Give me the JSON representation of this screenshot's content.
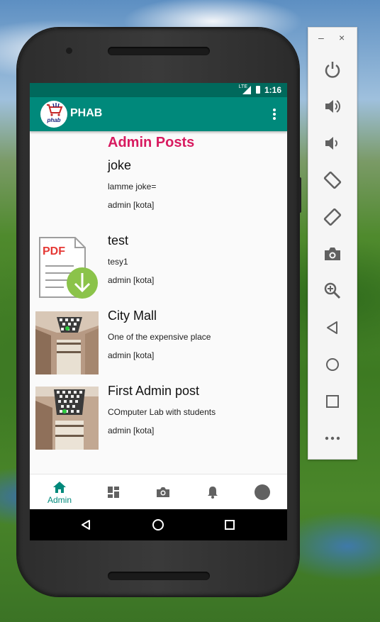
{
  "status_bar": {
    "time": "1:16",
    "network": "LTE"
  },
  "app_bar": {
    "title": "PHAB",
    "logo_text": "PHAB"
  },
  "page": {
    "section_title": "Admin Posts"
  },
  "posts": [
    {
      "title": "joke",
      "description": "lamme joke=",
      "author": "admin [kota]",
      "thumbnail": "none"
    },
    {
      "title": "test",
      "description": "tesy1",
      "author": "admin [kota]",
      "thumbnail": "pdf-download-icon",
      "thumb_label": "PDF"
    },
    {
      "title": "City Mall",
      "description": "One of the expensive place",
      "author": "admin [kota]",
      "thumbnail": "photo"
    },
    {
      "title": "First Admin post",
      "description": "COmputer Lab with students",
      "author": "admin [kota]",
      "thumbnail": "photo"
    }
  ],
  "bottom_nav": [
    {
      "icon": "home-icon",
      "label": "Admin",
      "active": true
    },
    {
      "icon": "dashboard-icon",
      "label": ""
    },
    {
      "icon": "camera-icon",
      "label": ""
    },
    {
      "icon": "bell-icon",
      "label": ""
    },
    {
      "icon": "avatar-icon",
      "label": ""
    }
  ],
  "emulator_controls": [
    "power-icon",
    "volume-up-icon",
    "volume-down-icon",
    "rotate-left-icon",
    "rotate-right-icon",
    "camera-icon",
    "zoom-icon",
    "back-icon",
    "home-icon",
    "overview-icon",
    "more-icon"
  ],
  "emulator_window": {
    "minimize": "–",
    "close": "×"
  },
  "colors": {
    "primary": "#00897b",
    "primary_dark": "#00695c",
    "accent": "#d81b60",
    "download_green": "#8bc34a",
    "pdf_red": "#e53935"
  }
}
